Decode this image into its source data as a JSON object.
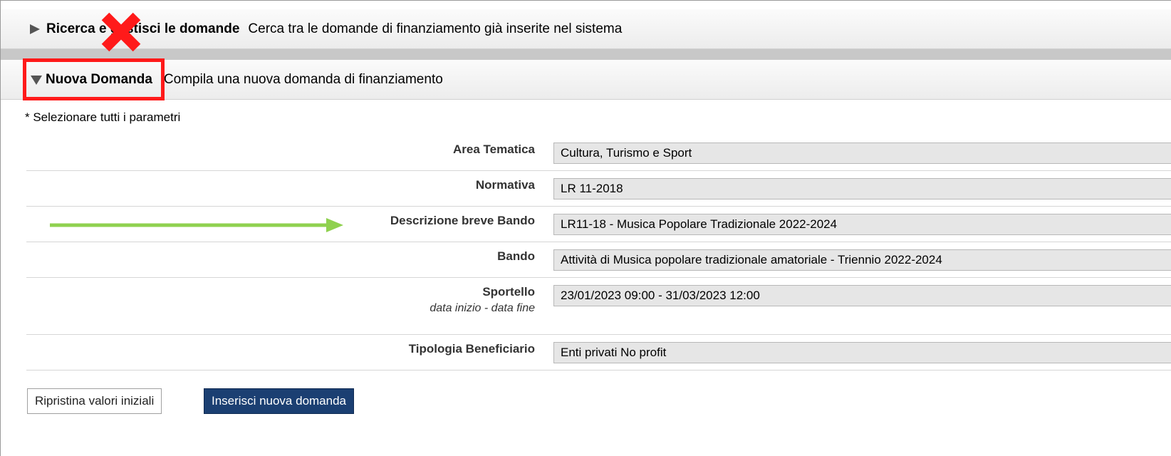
{
  "search_section": {
    "title": "Ricerca e gestisci le domande",
    "description": "Cerca tra le domande di finanziamento già inserite nel sistema"
  },
  "new_section": {
    "title": "Nuova Domanda",
    "description": "Compila una nuova domanda di finanziamento"
  },
  "note": "* Selezionare tutti i parametri",
  "fields": [
    {
      "label": "Area Tematica",
      "value": "Cultura, Turismo e Sport"
    },
    {
      "label": "Normativa",
      "value": "LR 11-2018"
    },
    {
      "label": "Descrizione breve Bando",
      "value": "LR11-18 - Musica Popolare Tradizionale 2022-2024"
    },
    {
      "label": "Bando",
      "value": "Attività di Musica popolare tradizionale amatoriale - Triennio 2022-2024"
    },
    {
      "label": "Sportello",
      "sublabel": "data inizio - data fine",
      "value": "23/01/2023 09:00 - 31/03/2023 12:00"
    },
    {
      "label": "Tipologia Beneficiario",
      "value": "Enti privati No profit"
    }
  ],
  "buttons": {
    "reset": "Ripristina valori iniziali",
    "insert": "Inserisci nuova domanda"
  },
  "colors": {
    "highlight_box": "#ff1a1a",
    "arrow": "#8fd14f",
    "primary_button": "#1b3f72"
  },
  "icons": {
    "collapsed": "triangle-right-icon",
    "expanded": "triangle-down-icon",
    "overlay_cross": "red-x-icon",
    "pointer": "green-arrow-icon"
  }
}
